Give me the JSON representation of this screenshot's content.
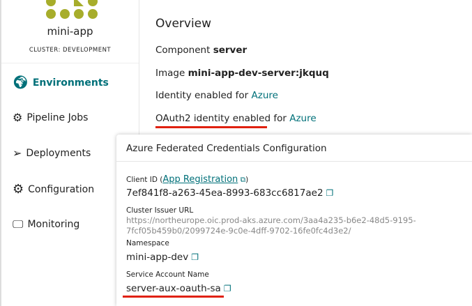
{
  "sidebar": {
    "app_name": "mini-app",
    "cluster": "CLUSTER: DEVELOPMENT",
    "items": [
      {
        "label": "Environments",
        "icon": "globe-icon"
      },
      {
        "label": "Pipeline Jobs",
        "icon": "pipeline-icon"
      },
      {
        "label": "Deployments",
        "icon": "send-icon"
      },
      {
        "label": "Configuration",
        "icon": "gear-icon"
      },
      {
        "label": "Monitoring",
        "icon": "monitor-icon"
      }
    ]
  },
  "overview": {
    "title": "Overview",
    "component_label": "Component",
    "component": "server",
    "image_label": "Image",
    "image": "mini-app-dev-server:jkquq",
    "identity_label": "Identity enabled for",
    "identity_link": "Azure",
    "oauth_label": "OAuth2 identity enabled for",
    "oauth_link": "Azure"
  },
  "popover": {
    "title": "Azure Federated Credentials Configuration",
    "client_id_label": "Client ID (",
    "app_reg_link": "App Registration",
    "client_id_close": ")",
    "client_id": "7ef841f8-a263-45ea-8993-683cc6817ae2",
    "issuer_label": "Cluster Issuer URL",
    "issuer_url": "https://northeurope.oic.prod-aks.azure.com/3aa4a235-b6e2-48d5-9195-7fcf05b459b0/2099724e-9c0e-4dff-9702-16fe0fc4d3e2/",
    "namespace_label": "Namespace",
    "namespace": "mini-app-dev",
    "sa_label": "Service Account Name",
    "sa": "server-aux-oauth-sa"
  },
  "colors": {
    "accent": "#007079",
    "logo": "#a7ad2b",
    "underline": "#e0200e"
  }
}
